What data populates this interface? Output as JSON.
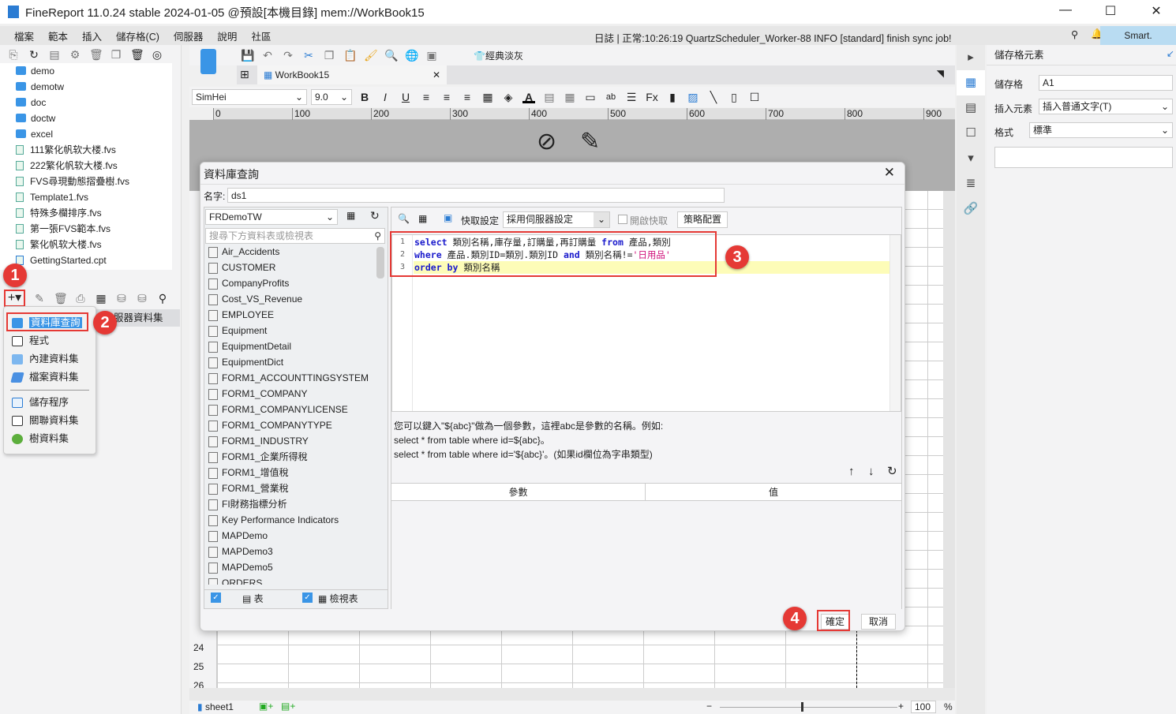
{
  "title": "FineReport 11.0.24 stable 2024-01-05 @預設[本機目錄]    mem://WorkBook15",
  "menu": [
    "檔案",
    "範本",
    "插入",
    "儲存格(C)",
    "伺服器",
    "說明",
    "社區"
  ],
  "log": "日誌 | 正常:10:26:19 QuartzScheduler_Worker-88 INFO [standard] finish sync job!",
  "smart": "Smart.",
  "tree": {
    "folders": [
      "demo",
      "demotw",
      "doc",
      "doctw",
      "excel"
    ],
    "files": [
      "111繁化帆软大楼.fvs",
      "222繁化帆软大楼.fvs",
      "FVS尋現動態摺疊樹.fvs",
      "Template1.fvs",
      "特殊多欄排序.fvs",
      "第一張FVS範本.fvs",
      "繁化帆软大楼.fvs",
      "GettingStarted.cpt"
    ]
  },
  "dataset_partial": "服器資料集",
  "popup": {
    "items": [
      "資料庫查詢",
      "程式",
      "內建資料集",
      "檔案資料集",
      "儲存程序",
      "關聯資料集",
      "樹資料集"
    ]
  },
  "workbook_tab": "WorkBook15",
  "style_label": "經典淡灰",
  "font": "SimHei",
  "font_size": "9.0",
  "ruler": [
    "0",
    "100",
    "200",
    "300",
    "400",
    "500",
    "600",
    "700",
    "800",
    "900"
  ],
  "rows": [
    "24",
    "25",
    "26"
  ],
  "sheet_tab": "sheet1",
  "zoom": "100",
  "zoom_unit": "%",
  "right_panel": {
    "title": "儲存格元素",
    "cell_label": "儲存格",
    "cell_value": "A1",
    "insert_label": "插入元素",
    "insert_value": "插入普通文字(T)",
    "format_label": "格式",
    "format_value": "標準"
  },
  "dialog": {
    "title": "資料庫查詢",
    "name_label": "名字:",
    "name_value": "ds1",
    "connection": "FRDemoTW",
    "search_placeholder": "搜尋下方資料表或檢視表",
    "tables": [
      "Air_Accidents",
      "CUSTOMER",
      "CompanyProfits",
      "Cost_VS_Revenue",
      "EMPLOYEE",
      "Equipment",
      "EquipmentDetail",
      "EquipmentDict",
      "FORM1_ACCOUNTTINGSYSTEM",
      "FORM1_COMPANY",
      "FORM1_COMPANYLICENSE",
      "FORM1_COMPANYTYPE",
      "FORM1_INDUSTRY",
      "FORM1_企業所得稅",
      "FORM1_增值稅",
      "FORM1_營業稅",
      "FI財務指標分析",
      "Key Performance Indicators",
      "MAPDemo",
      "MAPDemo3",
      "MAPDemo5",
      "ORDERS"
    ],
    "check_table": "表",
    "check_view": "檢視表",
    "cache_label": "快取設定",
    "cache_value": "採用伺服器設定",
    "enable_cache": "開啟快取",
    "strategy": "策略配置",
    "sql_lines": [
      [
        [
          "kw",
          "select"
        ],
        [
          "t",
          " 類別名稱,庫存量,訂購量,再訂購量 "
        ],
        [
          "kw",
          "from"
        ],
        [
          "t",
          " 產品,類別"
        ]
      ],
      [
        [
          "kw",
          "where"
        ],
        [
          "t",
          " 產品.類別ID=類別.類別ID "
        ],
        [
          "kw",
          "and"
        ],
        [
          "t",
          " 類別名稱!="
        ],
        [
          "str",
          "'日用品'"
        ]
      ],
      [
        [
          "kw",
          "order by"
        ],
        [
          "t",
          " 類別名稱"
        ]
      ]
    ],
    "help": [
      "您可以鍵入\"${abc}\"做為一個參數，這裡abc是參數的名稱。例如:",
      "select * from table where id=${abc}。",
      "select * from table where id='${abc}'。(如果id欄位為字串類型)"
    ],
    "param_col": "參數",
    "value_col": "值",
    "ok": "確定",
    "cancel": "取消"
  },
  "badges": [
    "1",
    "2",
    "3",
    "4"
  ],
  "colors": {
    "accent": "#3a95e6",
    "highlight": "#e53935",
    "sql_keyword": "#1a1acc",
    "sql_string": "#d0107a"
  }
}
